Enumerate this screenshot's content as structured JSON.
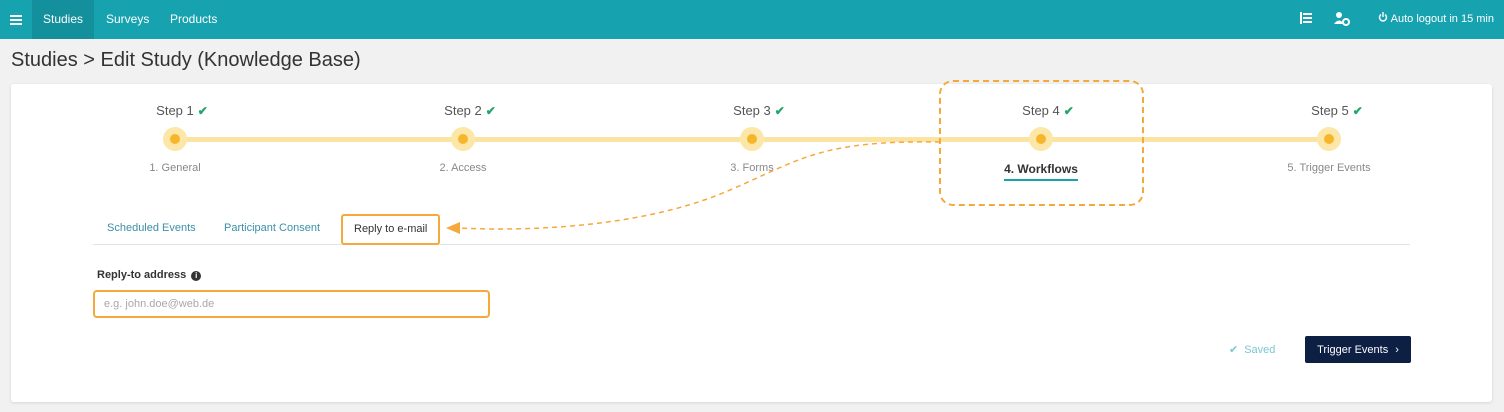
{
  "header": {
    "nav": [
      {
        "label": "Studies",
        "active": true
      },
      {
        "label": "Surveys",
        "active": false
      },
      {
        "label": "Products",
        "active": false
      }
    ],
    "logout_text": "Auto logout in 15 min"
  },
  "breadcrumb": {
    "root": "Studies",
    "separator": ">",
    "current": "Edit Study (Knowledge Base)"
  },
  "steps": [
    {
      "title": "Step 1",
      "label": "1. General",
      "done": true,
      "current": false
    },
    {
      "title": "Step 2",
      "label": "2. Access",
      "done": true,
      "current": false
    },
    {
      "title": "Step 3",
      "label": "3. Forms",
      "done": true,
      "current": false
    },
    {
      "title": "Step 4",
      "label": "4. Workflows",
      "done": true,
      "current": true
    },
    {
      "title": "Step 5",
      "label": "5. Trigger Events",
      "done": true,
      "current": false
    }
  ],
  "tabs": [
    {
      "label": "Scheduled Events",
      "active": false
    },
    {
      "label": "Participant Consent",
      "active": false
    },
    {
      "label": "Reply to e-mail",
      "active": true
    }
  ],
  "form": {
    "reply_to_label": "Reply-to address",
    "reply_to_value": "",
    "reply_to_placeholder": "e.g. john.doe@web.de"
  },
  "footer": {
    "saved_text": "Saved",
    "trigger_button": "Trigger Events"
  },
  "colors": {
    "topbar": "#17a2b0",
    "accent_orange": "#f5a93b",
    "check_green": "#22a56c",
    "button_dark": "#0e1f44"
  }
}
